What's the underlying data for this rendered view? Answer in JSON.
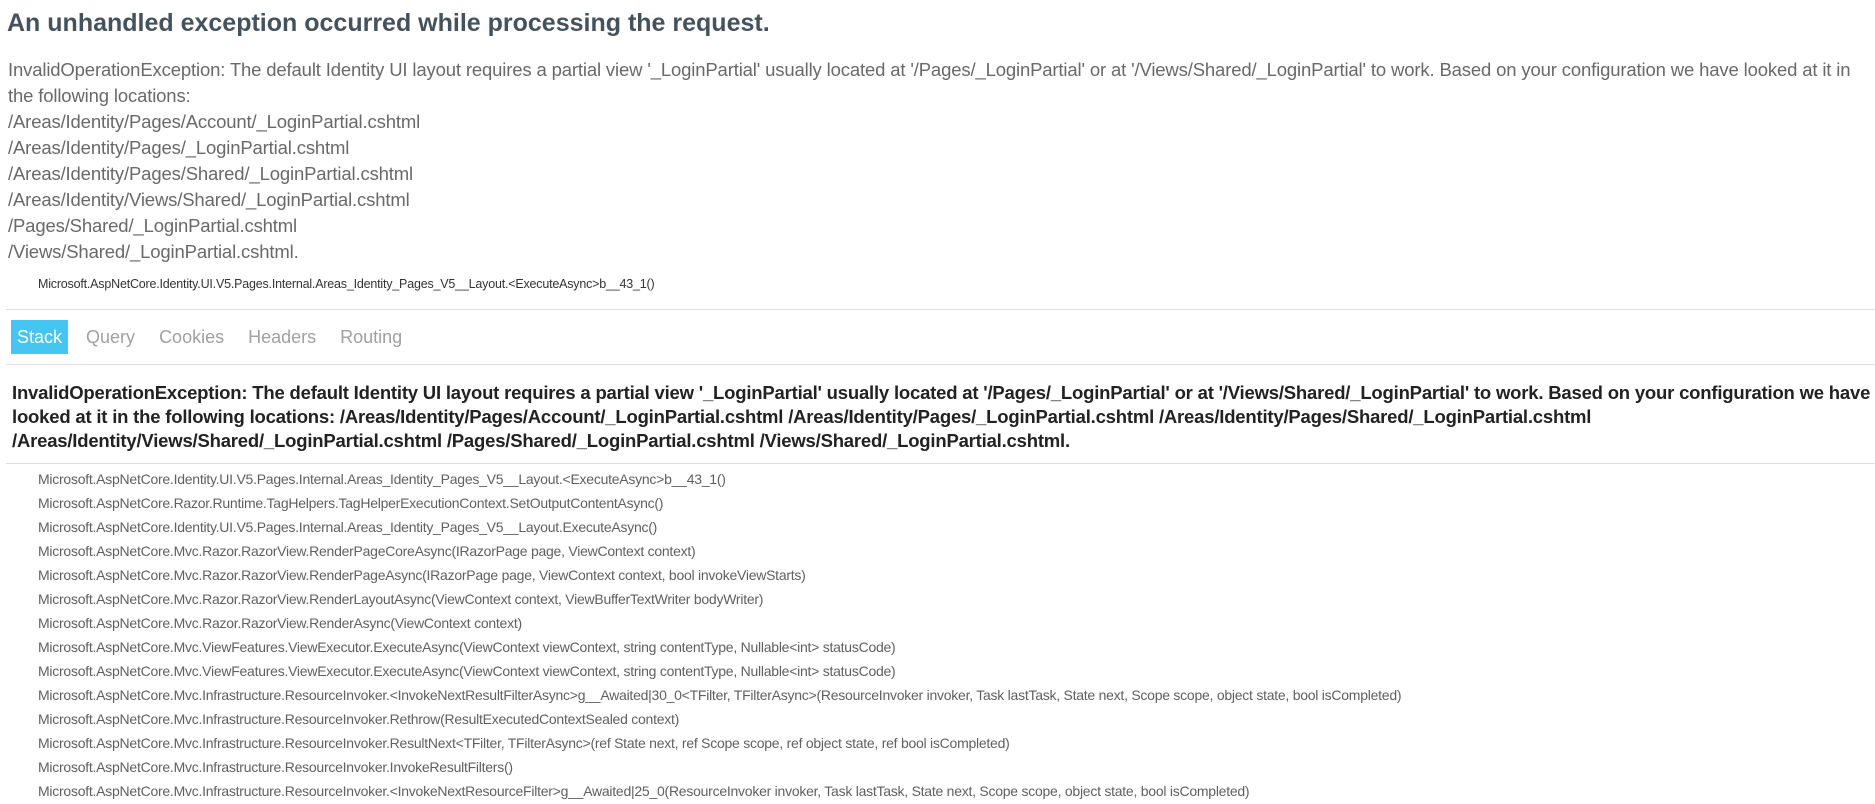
{
  "page": {
    "title": "An unhandled exception occurred while processing the request."
  },
  "error_summary": {
    "message": "InvalidOperationException: The default Identity UI layout requires a partial view '_LoginPartial' usually located at '/Pages/_LoginPartial' or at '/Views/Shared/_LoginPartial' to work. Based on your configuration we have looked at it in the following locations:",
    "locations": [
      "/Areas/Identity/Pages/Account/_LoginPartial.cshtml",
      "/Areas/Identity/Pages/_LoginPartial.cshtml",
      "/Areas/Identity/Pages/Shared/_LoginPartial.cshtml",
      "/Areas/Identity/Views/Shared/_LoginPartial.cshtml",
      "/Pages/Shared/_LoginPartial.cshtml",
      "/Views/Shared/_LoginPartial.cshtml."
    ],
    "top_frame": "Microsoft.AspNetCore.Identity.UI.V5.Pages.Internal.Areas_Identity_Pages_V5__Layout.<ExecuteAsync>b__43_1()"
  },
  "tabs": [
    {
      "label": "Stack",
      "selected": true
    },
    {
      "label": "Query",
      "selected": false
    },
    {
      "label": "Cookies",
      "selected": false
    },
    {
      "label": "Headers",
      "selected": false
    },
    {
      "label": "Routing",
      "selected": false
    }
  ],
  "stack": {
    "heading": "InvalidOperationException: The default Identity UI layout requires a partial view '_LoginPartial' usually located at '/Pages/_LoginPartial' or at '/Views/Shared/_LoginPartial' to work. Based on your configuration we have looked at it in the following locations: /Areas/Identity/Pages/Account/_LoginPartial.cshtml /Areas/Identity/Pages/_LoginPartial.cshtml /Areas/Identity/Pages/Shared/_LoginPartial.cshtml /Areas/Identity/Views/Shared/_LoginPartial.cshtml /Pages/Shared/_LoginPartial.cshtml /Views/Shared/_LoginPartial.cshtml.",
    "frames": [
      "Microsoft.AspNetCore.Identity.UI.V5.Pages.Internal.Areas_Identity_Pages_V5__Layout.<ExecuteAsync>b__43_1()",
      "Microsoft.AspNetCore.Razor.Runtime.TagHelpers.TagHelperExecutionContext.SetOutputContentAsync()",
      "Microsoft.AspNetCore.Identity.UI.V5.Pages.Internal.Areas_Identity_Pages_V5__Layout.ExecuteAsync()",
      "Microsoft.AspNetCore.Mvc.Razor.RazorView.RenderPageCoreAsync(IRazorPage page, ViewContext context)",
      "Microsoft.AspNetCore.Mvc.Razor.RazorView.RenderPageAsync(IRazorPage page, ViewContext context, bool invokeViewStarts)",
      "Microsoft.AspNetCore.Mvc.Razor.RazorView.RenderLayoutAsync(ViewContext context, ViewBufferTextWriter bodyWriter)",
      "Microsoft.AspNetCore.Mvc.Razor.RazorView.RenderAsync(ViewContext context)",
      "Microsoft.AspNetCore.Mvc.ViewFeatures.ViewExecutor.ExecuteAsync(ViewContext viewContext, string contentType, Nullable<int> statusCode)",
      "Microsoft.AspNetCore.Mvc.ViewFeatures.ViewExecutor.ExecuteAsync(ViewContext viewContext, string contentType, Nullable<int> statusCode)",
      "Microsoft.AspNetCore.Mvc.Infrastructure.ResourceInvoker.<InvokeNextResultFilterAsync>g__Awaited|30_0<TFilter, TFilterAsync>(ResourceInvoker invoker, Task lastTask, State next, Scope scope, object state, bool isCompleted)",
      "Microsoft.AspNetCore.Mvc.Infrastructure.ResourceInvoker.Rethrow(ResultExecutedContextSealed context)",
      "Microsoft.AspNetCore.Mvc.Infrastructure.ResourceInvoker.ResultNext<TFilter, TFilterAsync>(ref State next, ref Scope scope, ref object state, ref bool isCompleted)",
      "Microsoft.AspNetCore.Mvc.Infrastructure.ResourceInvoker.InvokeResultFilters()",
      "Microsoft.AspNetCore.Mvc.Infrastructure.ResourceInvoker.<InvokeNextResourceFilter>g__Awaited|25_0(ResourceInvoker invoker, Task lastTask, State next, Scope scope, object state, bool isCompleted)"
    ]
  },
  "colors": {
    "title": "#44525e",
    "summary_text": "#696969",
    "tab_selected_bg": "#44c5f2",
    "tab_text": "#a0a0a0",
    "frame_text": "#606060",
    "divider": "#dddddd"
  }
}
